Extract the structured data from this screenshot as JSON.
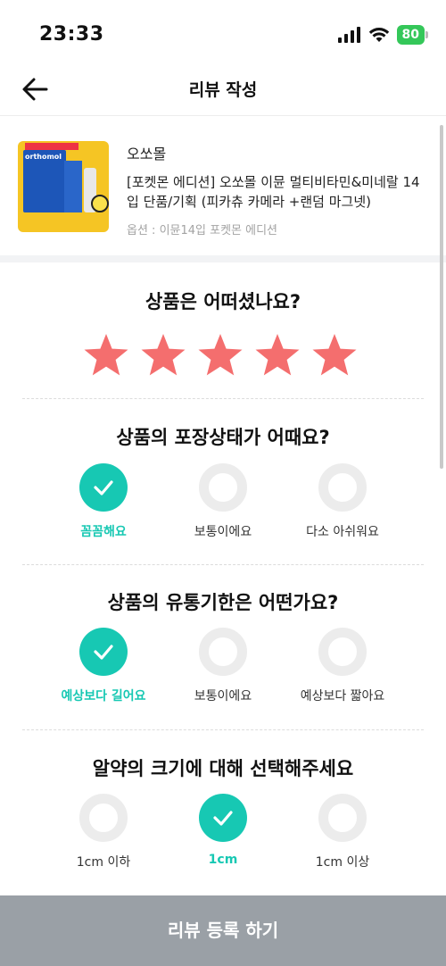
{
  "status_bar": {
    "time": "23:33",
    "battery": "80"
  },
  "header": {
    "title": "리뷰 작성",
    "back_icon": "arrow-left-icon"
  },
  "product": {
    "brand": "오쏘몰",
    "name": "[포켓몬 에디션] 오쏘몰 이뮨 멀티비타민&미네랄 14입 단품/기획 (피카츄 카메라 +랜덤 마그넷)",
    "option": "옵션 : 이뮨14입 포켓몬 에디션"
  },
  "rating": {
    "question": "상품은 어떠셨나요?",
    "stars": 5,
    "max": 5,
    "color": "#f46e6e"
  },
  "questions": [
    {
      "question": "상품의 포장상태가 어때요?",
      "options": [
        "꼼꼼해요",
        "보통이에요",
        "다소 아쉬워요"
      ],
      "selected": 0
    },
    {
      "question": "상품의 유통기한은 어떤가요?",
      "options": [
        "예상보다 길어요",
        "보통이에요",
        "예상보다 짧아요"
      ],
      "selected": 0
    },
    {
      "question": "알약의 크기에 대해 선택해주세요",
      "options": [
        "1cm 이하",
        "1cm",
        "1cm 이상"
      ],
      "selected": 1
    }
  ],
  "accent_color": "#17c8b3",
  "submit": {
    "label": "리뷰 등록 하기"
  }
}
